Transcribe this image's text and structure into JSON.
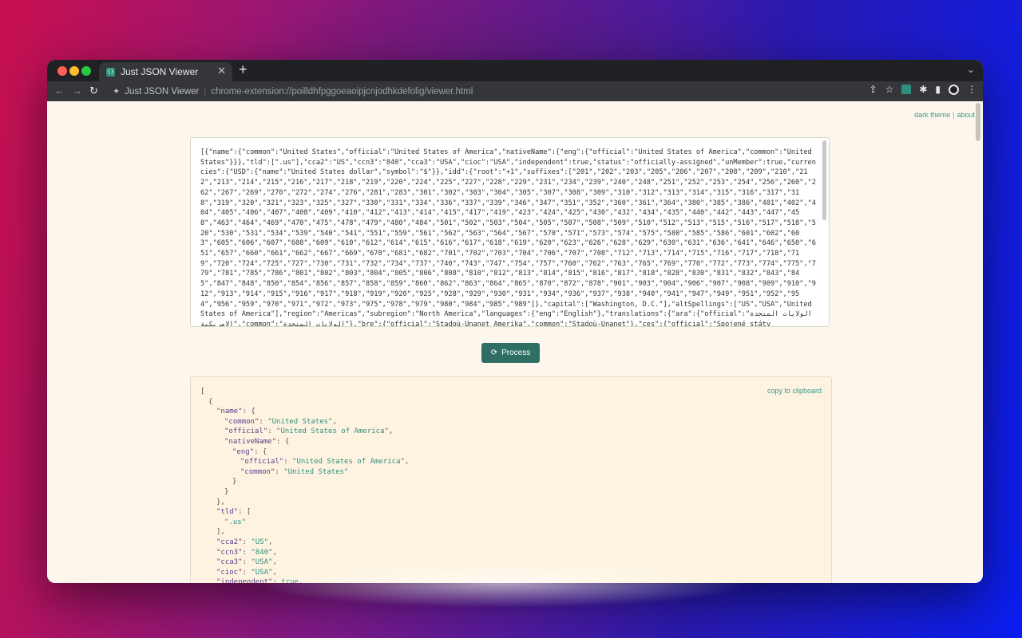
{
  "browser": {
    "tab_title": "Just JSON Viewer",
    "tab_favicon_text": "{}",
    "new_tab_symbol": "+",
    "site_name": "Just JSON Viewer",
    "url": "chrome-extension://poilldhfpggoeaoipjcnjodhkdefolig/viewer.html"
  },
  "page": {
    "links": {
      "dark_theme": "dark theme",
      "about": "about",
      "sep": "|"
    },
    "input_text": "[{\"name\":{\"common\":\"United States\",\"official\":\"United States of America\",\"nativeName\":{\"eng\":{\"official\":\"United States of America\",\"common\":\"United States\"}}},\"tld\":[\".us\"],\"cca2\":\"US\",\"ccn3\":\"840\",\"cca3\":\"USA\",\"cioc\":\"USA\",\"independent\":true,\"status\":\"officially-assigned\",\"unMember\":true,\"currencies\":{\"USD\":{\"name\":\"United States dollar\",\"symbol\":\"$\"}},\"idd\":{\"root\":\"+1\",\"suffixes\":[\"201\",\"202\",\"203\",\"205\",\"206\",\"207\",\"208\",\"209\",\"210\",\"212\",\"213\",\"214\",\"215\",\"216\",\"217\",\"218\",\"219\",\"220\",\"224\",\"225\",\"227\",\"228\",\"229\",\"231\",\"234\",\"239\",\"240\",\"248\",\"251\",\"252\",\"253\",\"254\",\"256\",\"260\",\"262\",\"267\",\"269\",\"270\",\"272\",\"274\",\"276\",\"281\",\"283\",\"301\",\"302\",\"303\",\"304\",\"305\",\"307\",\"308\",\"309\",\"310\",\"312\",\"313\",\"314\",\"315\",\"316\",\"317\",\"318\",\"319\",\"320\",\"321\",\"323\",\"325\",\"327\",\"330\",\"331\",\"334\",\"336\",\"337\",\"339\",\"346\",\"347\",\"351\",\"352\",\"360\",\"361\",\"364\",\"380\",\"385\",\"386\",\"401\",\"402\",\"404\",\"405\",\"406\",\"407\",\"408\",\"409\",\"410\",\"412\",\"413\",\"414\",\"415\",\"417\",\"419\",\"423\",\"424\",\"425\",\"430\",\"432\",\"434\",\"435\",\"440\",\"442\",\"443\",\"447\",\"458\",\"463\",\"464\",\"469\",\"470\",\"475\",\"478\",\"479\",\"480\",\"484\",\"501\",\"502\",\"503\",\"504\",\"505\",\"507\",\"508\",\"509\",\"510\",\"512\",\"513\",\"515\",\"516\",\"517\",\"518\",\"520\",\"530\",\"531\",\"534\",\"539\",\"540\",\"541\",\"551\",\"559\",\"561\",\"562\",\"563\",\"564\",\"567\",\"570\",\"571\",\"573\",\"574\",\"575\",\"580\",\"585\",\"586\",\"601\",\"602\",\"603\",\"605\",\"606\",\"607\",\"608\",\"609\",\"610\",\"612\",\"614\",\"615\",\"616\",\"617\",\"618\",\"619\",\"620\",\"623\",\"626\",\"628\",\"629\",\"630\",\"631\",\"636\",\"641\",\"646\",\"650\",\"651\",\"657\",\"660\",\"661\",\"662\",\"667\",\"669\",\"678\",\"681\",\"682\",\"701\",\"702\",\"703\",\"704\",\"706\",\"707\",\"708\",\"712\",\"713\",\"714\",\"715\",\"716\",\"717\",\"718\",\"719\",\"720\",\"724\",\"725\",\"727\",\"730\",\"731\",\"732\",\"734\",\"737\",\"740\",\"743\",\"747\",\"754\",\"757\",\"760\",\"762\",\"763\",\"765\",\"769\",\"770\",\"772\",\"773\",\"774\",\"775\",\"779\",\"781\",\"785\",\"786\",\"801\",\"802\",\"803\",\"804\",\"805\",\"806\",\"808\",\"810\",\"812\",\"813\",\"814\",\"815\",\"816\",\"817\",\"818\",\"828\",\"830\",\"831\",\"832\",\"843\",\"845\",\"847\",\"848\",\"850\",\"854\",\"856\",\"857\",\"858\",\"859\",\"860\",\"862\",\"863\",\"864\",\"865\",\"870\",\"872\",\"878\",\"901\",\"903\",\"904\",\"906\",\"907\",\"908\",\"909\",\"910\",\"912\",\"913\",\"914\",\"915\",\"916\",\"917\",\"918\",\"919\",\"920\",\"925\",\"928\",\"929\",\"930\",\"931\",\"934\",\"936\",\"937\",\"938\",\"940\",\"941\",\"947\",\"949\",\"951\",\"952\",\"954\",\"956\",\"959\",\"970\",\"971\",\"972\",\"973\",\"975\",\"978\",\"979\",\"980\",\"984\",\"985\",\"989\"]},\"capital\":[\"Washington, D.C.\"],\"altSpellings\":[\"US\",\"USA\",\"United States of America\"],\"region\":\"Americas\",\"subregion\":\"North America\",\"languages\":{\"eng\":\"English\"},\"translations\":{\"ara\":{\"official\":\"الولايات المتحدة الامريكية\",\"common\":\"الولايات المتحدة\"},\"bre\":{\"official\":\"Stadoù-Unanet Amerika\",\"common\":\"Stadoù-Unanet\"},\"ces\":{\"official\":\"Spojené státy",
    "process_label": "Process",
    "copy_label": "copy to clipboard",
    "output_lines": [
      {
        "indent": 0,
        "text": "["
      },
      {
        "indent": 1,
        "text": "{"
      },
      {
        "indent": 2,
        "key": "name",
        "after": ": {"
      },
      {
        "indent": 3,
        "key": "common",
        "value": "United States",
        "after": ","
      },
      {
        "indent": 3,
        "key": "official",
        "value": "United States of America",
        "after": ","
      },
      {
        "indent": 3,
        "key": "nativeName",
        "after": ": {"
      },
      {
        "indent": 4,
        "key": "eng",
        "after": ": {"
      },
      {
        "indent": 5,
        "key": "official",
        "value": "United States of America",
        "after": ","
      },
      {
        "indent": 5,
        "key": "common",
        "value": "United States",
        "after": ""
      },
      {
        "indent": 4,
        "text": "}"
      },
      {
        "indent": 3,
        "text": "}"
      },
      {
        "indent": 2,
        "text": "},"
      },
      {
        "indent": 2,
        "key": "tld",
        "after": ": ["
      },
      {
        "indent": 3,
        "value": ".us",
        "after": ""
      },
      {
        "indent": 2,
        "text": "],"
      },
      {
        "indent": 2,
        "key": "cca2",
        "value": "US",
        "after": ","
      },
      {
        "indent": 2,
        "key": "ccn3",
        "value": "840",
        "after": ","
      },
      {
        "indent": 2,
        "key": "cca3",
        "value": "USA",
        "after": ","
      },
      {
        "indent": 2,
        "key": "cioc",
        "value": "USA",
        "after": ","
      },
      {
        "indent": 2,
        "key": "independent",
        "bool": "true",
        "after": ","
      }
    ]
  }
}
